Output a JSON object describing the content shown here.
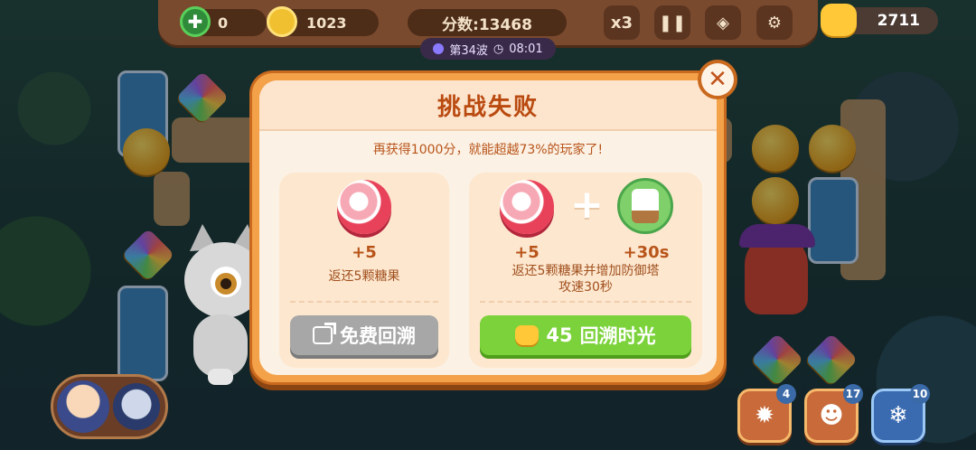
{
  "hud": {
    "health": "0",
    "gold": "1023",
    "score": "分数:13468",
    "wave": "第34波",
    "timer": "08:01",
    "speed_label": "x3",
    "currency": "2711"
  },
  "dialog": {
    "title": "挑战失败",
    "subtitle": "再获得1000分，就能超越73%的玩家了!",
    "left_card": {
      "amount": "+5",
      "description": "返还5颗糖果",
      "button_label": "免费回溯"
    },
    "right_card": {
      "amount_candy": "+5",
      "amount_time": "+30s",
      "description_line1": "返还5颗糖果并增加防御塔",
      "description_line2": "攻速30秒",
      "button_cost": "45",
      "button_label": "回溯时光"
    }
  },
  "skills": [
    {
      "icon": "bomb-icon",
      "count": "4"
    },
    {
      "icon": "cat-bell-icon",
      "count": "17"
    },
    {
      "icon": "snowflake-icon",
      "count": "10"
    }
  ],
  "colors": {
    "accent_orange": "#f4a24a",
    "title_red": "#b94a10",
    "green_button": "#7bd23a",
    "gray_button": "#a7a7a7"
  }
}
